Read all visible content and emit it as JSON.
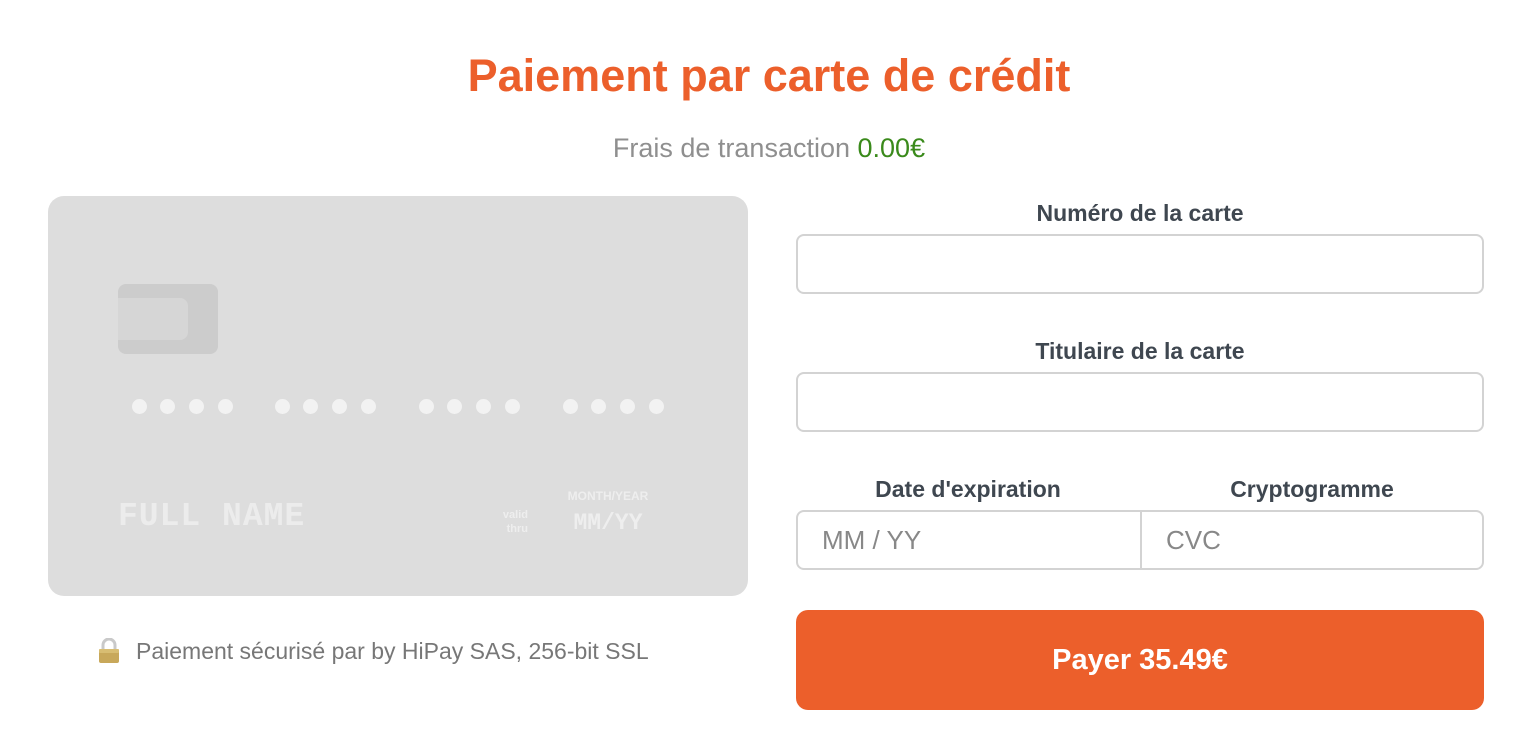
{
  "header": {
    "title": "Paiement par carte de crédit",
    "fee_label": "Frais de transaction",
    "fee_amount": "0.00€"
  },
  "card_preview": {
    "name_placeholder": "FULL NAME",
    "valid_thru_line1": "valid",
    "valid_thru_line2": "thru",
    "month_year_label": "MONTH/YEAR",
    "expiry_placeholder": "MM/YY",
    "number_groups": 4,
    "dots_per_group": 4
  },
  "secure_note": {
    "icon": "lock-icon",
    "text": "Paiement sécurisé par by HiPay SAS, 256-bit SSL"
  },
  "form": {
    "card_number": {
      "label": "Numéro de la carte",
      "value": "",
      "placeholder": ""
    },
    "card_holder": {
      "label": "Titulaire de la carte",
      "value": "",
      "placeholder": ""
    },
    "expiry": {
      "label": "Date d'expiration",
      "value": "",
      "placeholder": "MM / YY"
    },
    "cvc": {
      "label": "Cryptogramme",
      "value": "",
      "placeholder": "CVC"
    },
    "pay_button_label": "Payer 35.49€"
  },
  "colors": {
    "accent": "#ec5f2b",
    "fee_amount": "#3a8a1b",
    "card_background": "#dddddd"
  }
}
